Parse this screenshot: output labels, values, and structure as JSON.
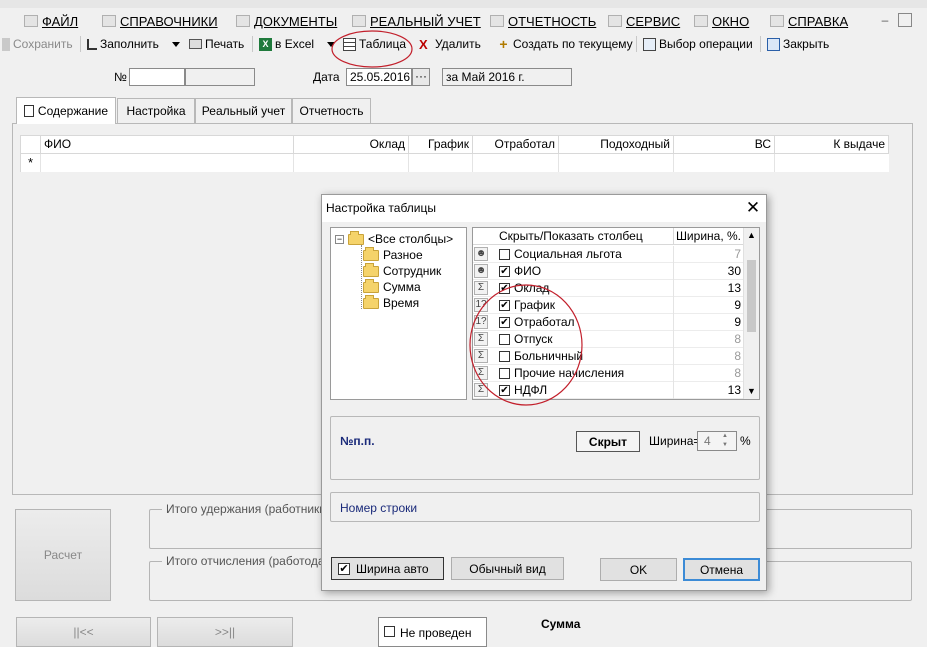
{
  "menu": {
    "items": [
      {
        "label": "ФАЙЛ",
        "icon": "folder-icon"
      },
      {
        "label": "СПРАВОЧНИКИ",
        "icon": "home-icon"
      },
      {
        "label": "ДОКУМЕНТЫ",
        "icon": "document-icon"
      },
      {
        "label": "РЕАЛЬНЫЙ УЧЕТ",
        "icon": "report-icon"
      },
      {
        "label": "ОТЧЕТНОСТЬ",
        "icon": "chart-icon"
      },
      {
        "label": "СЕРВИС",
        "icon": "service-icon"
      },
      {
        "label": "ОКНО",
        "icon": "window-icon"
      },
      {
        "label": "СПРАВКА",
        "icon": "help-icon"
      }
    ],
    "minimize": "–"
  },
  "toolbar": {
    "save": "Сохранить",
    "fill": "Заполнить",
    "print": "Печать",
    "excel": "в Excel",
    "table": "Таблица",
    "delete": "Удалить",
    "create_from": "Создать по текущему",
    "choose_operation": "Выбор операции",
    "close": "Закрыть"
  },
  "header": {
    "number_label": "№",
    "number_value": "",
    "date_label": "Дата",
    "date_value": "25.05.2016",
    "date_button": "···",
    "period": "за Май 2016 г."
  },
  "tabs": [
    {
      "label": "Содержание",
      "active": true
    },
    {
      "label": "Настройка",
      "active": false
    },
    {
      "label": "Реальный учет",
      "active": false
    },
    {
      "label": "Отчетность",
      "active": false
    }
  ],
  "grid": {
    "columns": [
      "ФИО",
      "Оклад",
      "График",
      "Отработал",
      "Подоходный",
      "ВС",
      "К выдаче"
    ],
    "new_row_marker": "*"
  },
  "bottom": {
    "calc_button": "Расчет",
    "withholding_title": "Итого удержания (работники)",
    "contributions_title": "Итого отчисления (работодате",
    "nav_first": "||<<",
    "nav_last": ">>||",
    "not_posted": "Не проведен",
    "sum_label": "Сумма"
  },
  "dialog": {
    "title": "Настройка таблицы",
    "close_glyph": "✕",
    "tree": {
      "root": "<Все столбцы>",
      "expander": "−",
      "children": [
        "Разное",
        "Сотрудник",
        "Сумма",
        "Время"
      ]
    },
    "columns_header": {
      "toggle": "Скрыть/Показать столбец",
      "width": "Ширина, %."
    },
    "columns": [
      {
        "icon": "person-icon",
        "icon_glyph": "☻",
        "checked": false,
        "name": "Социальная льгота",
        "width": "7",
        "muted": true
      },
      {
        "icon": "person-icon",
        "icon_glyph": "☻",
        "checked": true,
        "name": "ФИО",
        "width": "30",
        "muted": false
      },
      {
        "icon": "sum-icon",
        "icon_glyph": "Σ",
        "checked": true,
        "name": "Оклад",
        "width": "13",
        "muted": false
      },
      {
        "icon": "number-icon",
        "icon_glyph": "1?",
        "checked": true,
        "name": "График",
        "width": "9",
        "muted": false
      },
      {
        "icon": "number-icon",
        "icon_glyph": "1?",
        "checked": true,
        "name": "Отработал",
        "width": "9",
        "muted": false
      },
      {
        "icon": "sum-icon",
        "icon_glyph": "Σ",
        "checked": false,
        "name": "Отпуск",
        "width": "8",
        "muted": true
      },
      {
        "icon": "sum-icon",
        "icon_glyph": "Σ",
        "checked": false,
        "name": "Больничный",
        "width": "8",
        "muted": true
      },
      {
        "icon": "sum-icon",
        "icon_glyph": "Σ",
        "checked": false,
        "name": "Прочие начисления",
        "width": "8",
        "muted": true
      },
      {
        "icon": "sum-icon",
        "icon_glyph": "Σ",
        "checked": true,
        "name": "НДФЛ",
        "width": "13",
        "muted": false
      }
    ],
    "props": {
      "column_name": "№п.п.",
      "hidden_button": "Скрыт",
      "width_label": "Ширина=",
      "width_value": "4",
      "percent": "%"
    },
    "description": "Номер строки",
    "auto_width_label": "Ширина авто",
    "auto_width_checked": true,
    "normal_view": "Обычный вид",
    "ok": "OK",
    "cancel": "Отмена"
  },
  "colors": {
    "annotation_red": "#c21f2b",
    "title_link": "#1a2a7a",
    "focus_blue": "#3c8bd6"
  }
}
